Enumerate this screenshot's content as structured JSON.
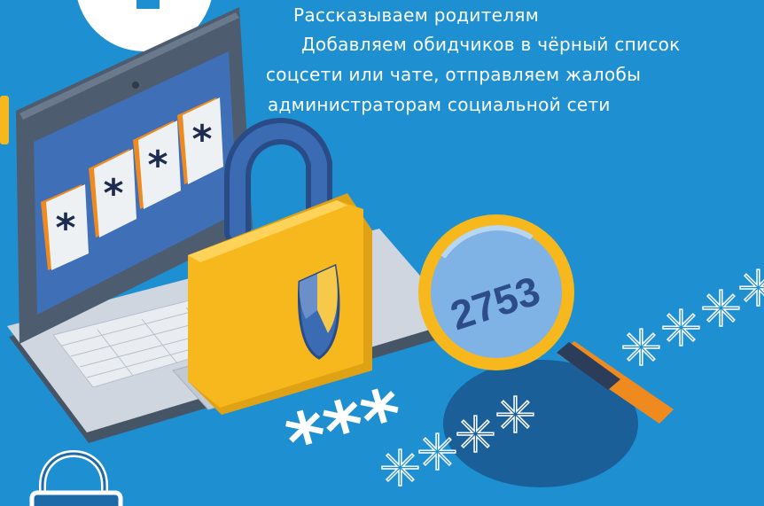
{
  "text": {
    "lines": [
      "Рассказываем родителям",
      "Добавляем обидчиков в чёрный список",
      "соцсети или чате, отправляем жалобы",
      "администраторам социальной сети"
    ]
  },
  "screen": {
    "masked_chars": [
      "*",
      "*",
      "*",
      "*"
    ]
  },
  "floating": {
    "bold_asterisks": "***"
  },
  "magnifier": {
    "code": "2753"
  },
  "colors": {
    "background": "#1e90d2",
    "laptop_body": "#4d5c6e",
    "screen": "#3f6fb6",
    "lock_body": "#f6b81c",
    "lock_shackle": "#3a5f9a",
    "magnifier_ring": "#f6b81c",
    "orange_accent": "#ef8a1f"
  }
}
